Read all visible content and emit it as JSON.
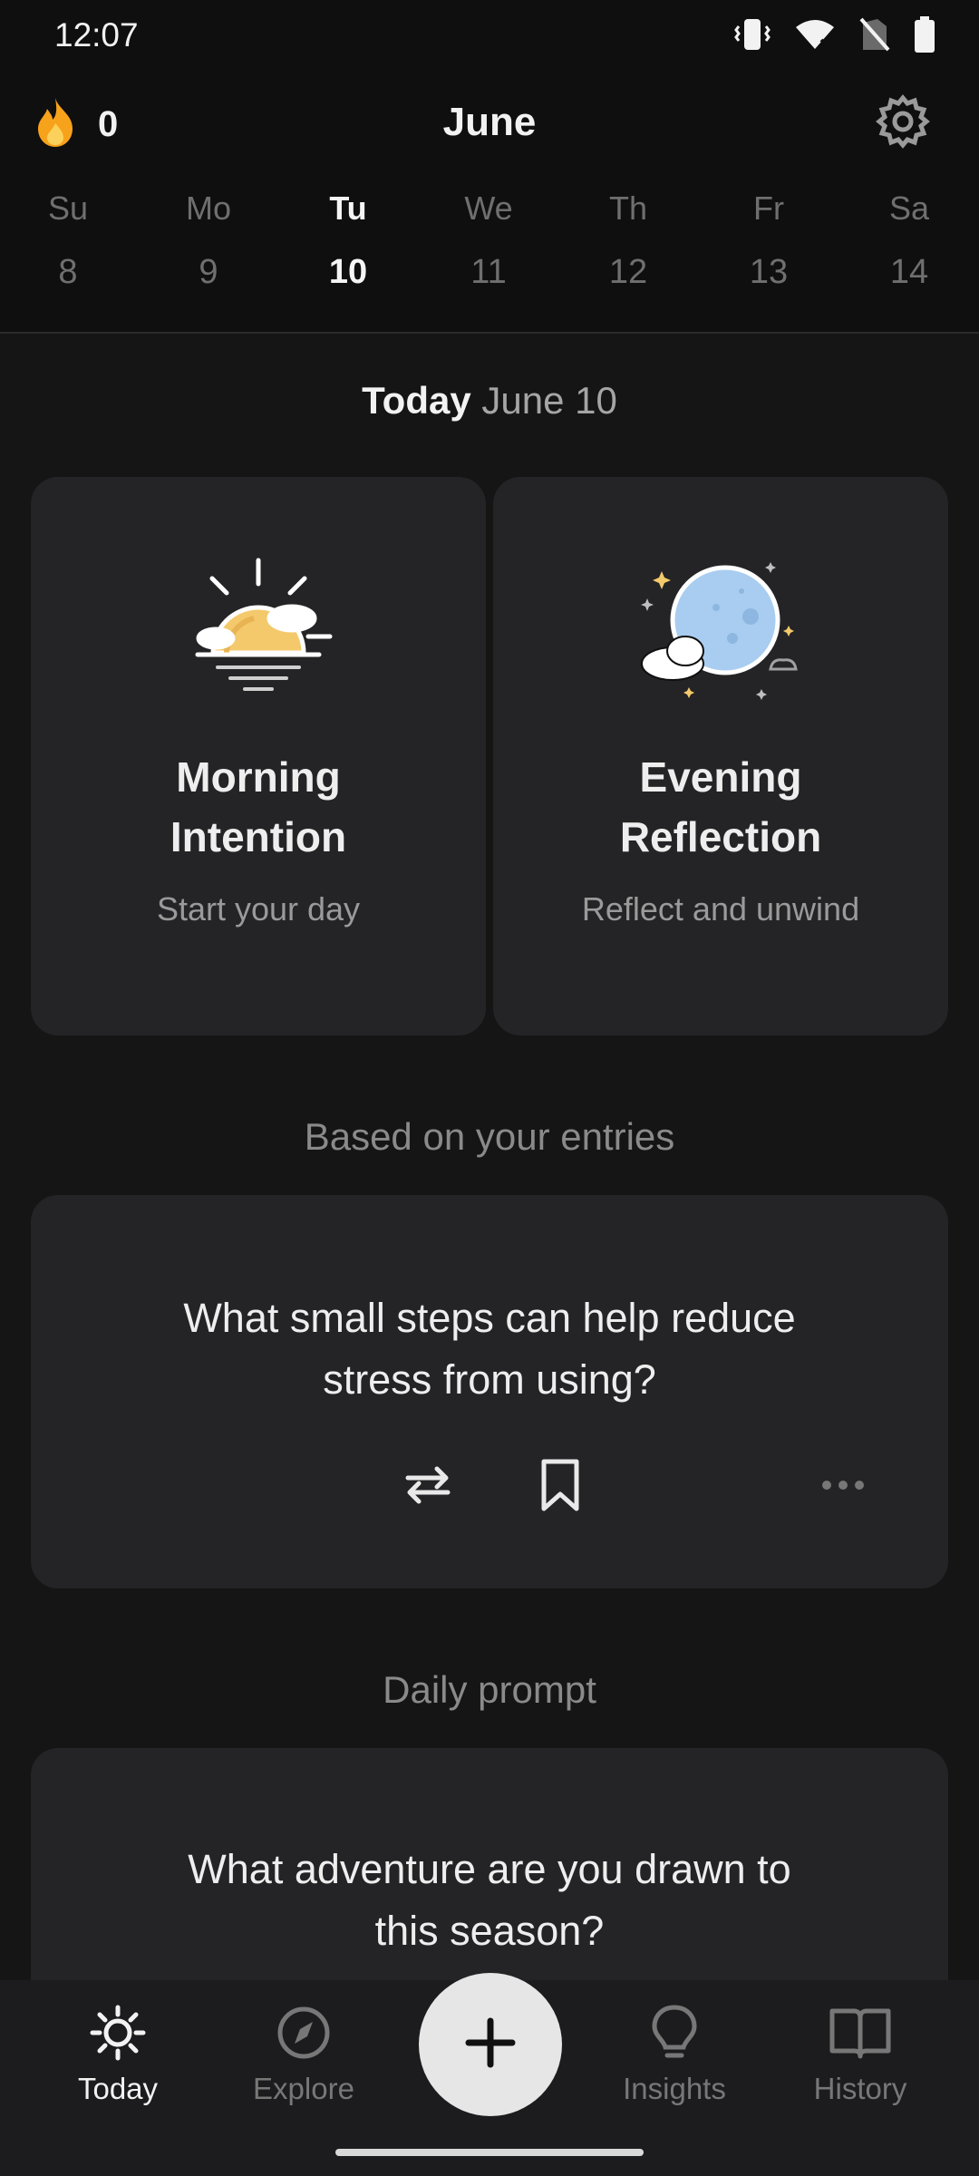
{
  "status": {
    "time": "12:07"
  },
  "header": {
    "streak_count": "0",
    "month": "June"
  },
  "week": [
    {
      "dow": "Su",
      "num": "8"
    },
    {
      "dow": "Mo",
      "num": "9"
    },
    {
      "dow": "Tu",
      "num": "10"
    },
    {
      "dow": "We",
      "num": "11"
    },
    {
      "dow": "Th",
      "num": "12"
    },
    {
      "dow": "Fr",
      "num": "13"
    },
    {
      "dow": "Sa",
      "num": "14"
    }
  ],
  "today": {
    "label": "Today",
    "date": "June 10"
  },
  "morning": {
    "title_line1": "Morning",
    "title_line2": "Intention",
    "subtitle": "Start your day"
  },
  "evening": {
    "title_line1": "Evening",
    "title_line2": "Reflection",
    "subtitle": "Reflect and unwind"
  },
  "entries_section": {
    "heading": "Based on your entries",
    "prompt_line1": "What small steps can help reduce",
    "prompt_line2": "stress from using?"
  },
  "daily_section": {
    "heading": "Daily prompt",
    "prompt_line1": "What adventure are you drawn to",
    "prompt_line2": "this season?"
  },
  "nav": {
    "today": "Today",
    "explore": "Explore",
    "insights": "Insights",
    "history": "History"
  },
  "colors": {
    "background": "#0f0f0f",
    "card": "#242426",
    "sun": "#f4c96b",
    "moon": "#a9cdf0",
    "streak_flame": "#f7a21b"
  }
}
